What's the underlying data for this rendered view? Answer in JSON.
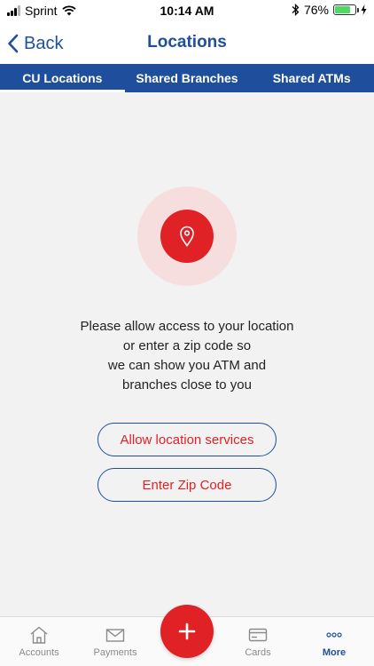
{
  "status_bar": {
    "carrier": "Sprint",
    "time": "10:14 AM",
    "battery_percent": "76%",
    "battery_level": 0.76,
    "icons": [
      "signal-icon",
      "wifi-icon",
      "bluetooth-icon",
      "battery-icon",
      "charging-icon"
    ]
  },
  "nav": {
    "back_label": "Back",
    "title": "Locations"
  },
  "tabs": [
    {
      "label": "CU Locations",
      "active": true
    },
    {
      "label": "Shared Branches",
      "active": false
    },
    {
      "label": "Shared ATMs",
      "active": false
    }
  ],
  "main": {
    "pin_icon": "location-pin-icon",
    "message_lines": [
      "Please allow access to your location",
      "or enter a zip code so",
      "we can show you ATM and",
      "branches close to you"
    ],
    "allow_button": "Allow location services",
    "zip_button": "Enter Zip Code"
  },
  "tab_bar": {
    "items": [
      {
        "label": "Accounts",
        "icon": "home-icon",
        "active": false
      },
      {
        "label": "Payments",
        "icon": "envelope-icon",
        "active": false
      },
      {
        "label": "Cards",
        "icon": "card-icon",
        "active": false
      },
      {
        "label": "More",
        "icon": "more-icon",
        "active": true
      }
    ],
    "fab_icon": "plus-icon"
  },
  "colors": {
    "brand_blue": "#1f4f9c",
    "accent_red": "#e02227",
    "halo_pink": "#f6dede",
    "background": "#f2f2f2"
  }
}
